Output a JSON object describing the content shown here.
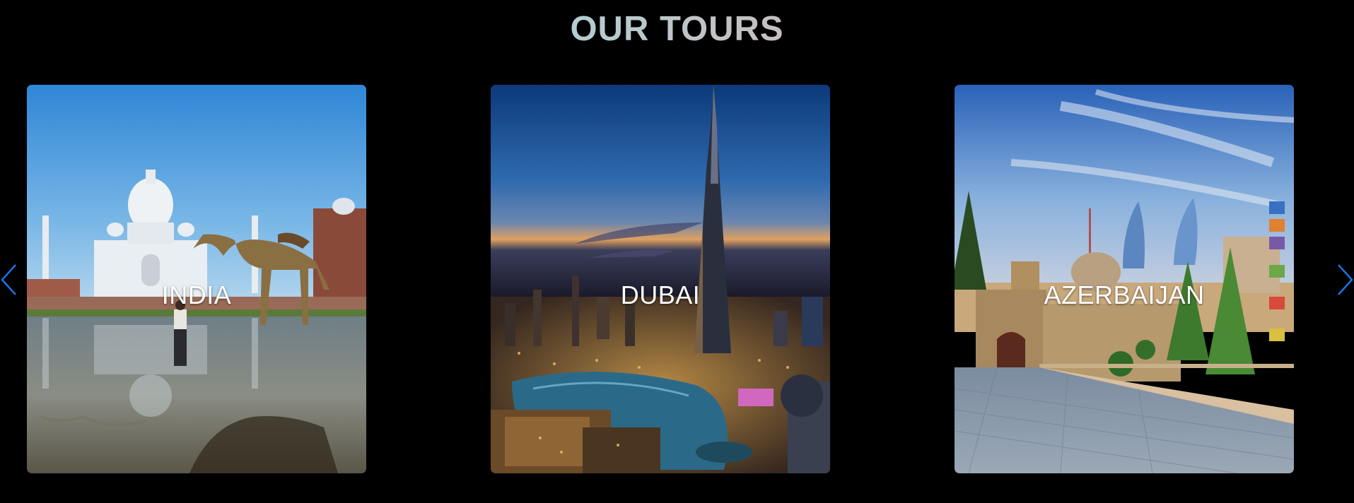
{
  "section": {
    "title": "OUR TOURS"
  },
  "tours": [
    {
      "label": "INDIA"
    },
    {
      "label": "DUBAI"
    },
    {
      "label": "AZERBAIJAN"
    }
  ],
  "navigation": {
    "prev_icon": "chevron-left-icon",
    "next_icon": "chevron-right-icon",
    "arrow_color": "#1a73e8"
  },
  "colors": {
    "background": "#000000",
    "label_text": "#ffffff",
    "title_gradient_start": "#8ee6f2",
    "title_gradient_end": "#d8a9b2"
  }
}
